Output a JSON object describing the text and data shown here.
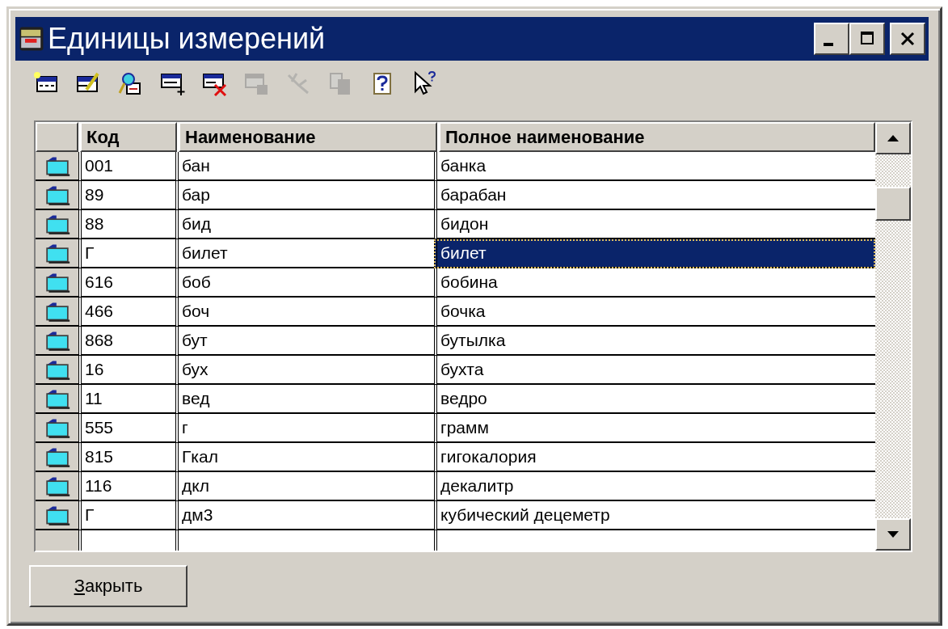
{
  "window": {
    "title": "Единицы измерений"
  },
  "toolbar": [
    {
      "kind": "new",
      "disabled": false
    },
    {
      "kind": "edit",
      "disabled": false
    },
    {
      "kind": "find",
      "disabled": false
    },
    {
      "kind": "add",
      "disabled": false
    },
    {
      "kind": "delete",
      "disabled": false
    },
    {
      "kind": "save",
      "disabled": true
    },
    {
      "kind": "tools",
      "disabled": true
    },
    {
      "kind": "copy",
      "disabled": true
    },
    {
      "kind": "help",
      "disabled": false
    },
    {
      "kind": "whatsthis",
      "disabled": false
    }
  ],
  "table": {
    "columns": [
      "Код",
      "Наименование",
      "Полное наименование"
    ],
    "rows": [
      {
        "code": "001",
        "name": "бан",
        "full_name": "банка",
        "selected": false
      },
      {
        "code": "89",
        "name": "бар",
        "full_name": "барабан",
        "selected": false
      },
      {
        "code": "88",
        "name": "бид",
        "full_name": "бидон",
        "selected": false
      },
      {
        "code": "Г",
        "name": "билет",
        "full_name": "билет",
        "selected": true
      },
      {
        "code": "616",
        "name": "боб",
        "full_name": "бобина",
        "selected": false
      },
      {
        "code": "466",
        "name": "боч",
        "full_name": "бочка",
        "selected": false
      },
      {
        "code": "868",
        "name": "бут",
        "full_name": "бутылка",
        "selected": false
      },
      {
        "code": "16",
        "name": "бух",
        "full_name": "бухта",
        "selected": false
      },
      {
        "code": "11",
        "name": "вед",
        "full_name": "ведро",
        "selected": false
      },
      {
        "code": "555",
        "name": "г",
        "full_name": "грамм",
        "selected": false
      },
      {
        "code": "815",
        "name": "Гкал",
        "full_name": "гигокалория",
        "selected": false
      },
      {
        "code": "116",
        "name": "дкл",
        "full_name": "декалитр",
        "selected": false
      },
      {
        "code": "Г",
        "name": "дм3",
        "full_name": "кубический децеметр",
        "selected": false
      }
    ]
  },
  "buttons": [
    "Закрыть"
  ]
}
